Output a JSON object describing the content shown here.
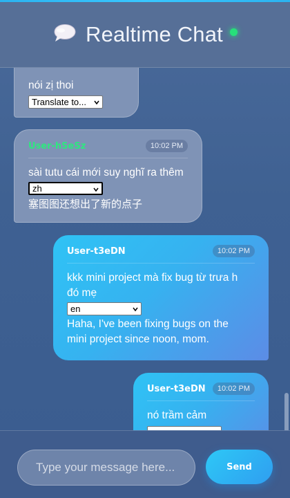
{
  "header": {
    "title": "Realtime Chat",
    "icon": "speech-bubble-icon",
    "status_color": "#27e07a"
  },
  "messages": [
    {
      "type": "received",
      "text": "nói zị thoi",
      "select": "Translate to..."
    },
    {
      "type": "received",
      "user": "User-hSeSz",
      "time": "10:02 PM",
      "text": "sài tutu cái mới suy nghĩ ra thêm",
      "select": "zh",
      "translation": "塞图图还想出了新的点子"
    },
    {
      "type": "sent",
      "user": "User-t3eDN",
      "time": "10:02 PM",
      "text_line1": "kkk mini project mà fix bug từ trưa h",
      "text_line2": "đó mẹ",
      "select": "en",
      "translation_line1": "Haha, I've been fixing bugs on the",
      "translation_line2": "mini project since noon, mom."
    },
    {
      "type": "sent",
      "user": "User-t3eDN",
      "time": "10:02 PM",
      "text": "nó trầm cảm"
    }
  ],
  "composer": {
    "placeholder": "Type your message here...",
    "send_label": "Send"
  },
  "colors": {
    "accent": "#2fc3f5",
    "received_user": "#2ee87f",
    "background": "#3f6192"
  }
}
